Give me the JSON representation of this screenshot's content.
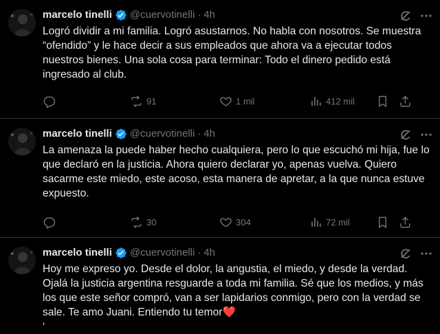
{
  "author": {
    "name": "marcelo tinelli",
    "handle": "@cuervotinelli"
  },
  "colors": {
    "background": "#000000",
    "text": "#e7e9ea",
    "muted": "#71767b",
    "verified": "#1d9bf0",
    "heart": "#f91880"
  },
  "tweets": [
    {
      "time": "4h",
      "text": "Logró dividir a mi familia. Logró asustarnos. No habla con nosotros. Se muestra “ofendido” y le hace decir a sus empleados que ahora va a ejecutar todos nuestros bienes. Una sola cosa para terminar: Todo el dinero pedido está ingresado al club.",
      "replies": "",
      "reposts": "91",
      "likes": "1 mil",
      "views": "412 mil"
    },
    {
      "time": "4h",
      "text": "La amenaza la puede haber hecho cualquiera, pero lo que  escuchó mi hija, fue lo que declaró en la justicia. Ahora quiero declarar yo, apenas vuelva. Quiero sacarme este miedo, este acoso, esta manera de apretar, a la que nunca estuve expuesto.",
      "replies": "",
      "reposts": "30",
      "likes": "304",
      "views": "72 mil"
    },
    {
      "time": "4h",
      "text": "Hoy me expreso yo. Desde el dolor, la angustia, el miedo, y desde la verdad. Ojalá la justicia argentina resguarde a toda mi familia. Sé que los medios, y más los que este señor compró, van a ser lapidarios conmigo, pero con la verdad se sale. Te amo Juani. Entiendo tu temor",
      "emoji": "❤️",
      "continuation": "‘"
    }
  ],
  "icons": [
    "avatar",
    "verified-badge-icon",
    "grok-icon",
    "more-icon",
    "reply-icon",
    "repost-icon",
    "like-icon",
    "views-icon",
    "bookmark-icon",
    "share-icon"
  ]
}
